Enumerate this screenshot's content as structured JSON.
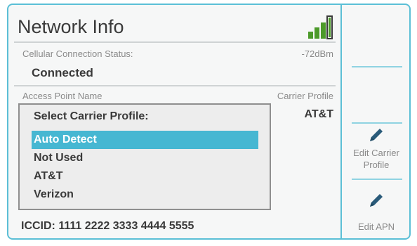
{
  "header": {
    "title": "Network Info",
    "signal_icon": "signal-bars-icon"
  },
  "cellular": {
    "label": "Cellular Connection Status:",
    "signal_strength": "-72dBm",
    "status": "Connected"
  },
  "access_point": {
    "label": "Access Point Name"
  },
  "carrier": {
    "label": "Carrier Profile",
    "value": "AT&T"
  },
  "profile_selector": {
    "title": "Select Carrier Profile:",
    "options": [
      "Auto Detect",
      "Not Used",
      "AT&T",
      "Verizon"
    ],
    "selected": "Auto Detect"
  },
  "iccid": {
    "text": "ICCID: 1111 2222 3333 4444 5555"
  },
  "sidebar": {
    "buttons": [
      {
        "label_line1": "Edit Carrier",
        "label_line2": "Profile",
        "icon": "pencil-icon"
      },
      {
        "label": "Edit APN",
        "icon": "pencil-icon"
      }
    ]
  },
  "colors": {
    "accent": "#46b7d2",
    "border": "#5bbfd6",
    "signal": "#4c9a2a",
    "text": "#3a3a3a"
  }
}
